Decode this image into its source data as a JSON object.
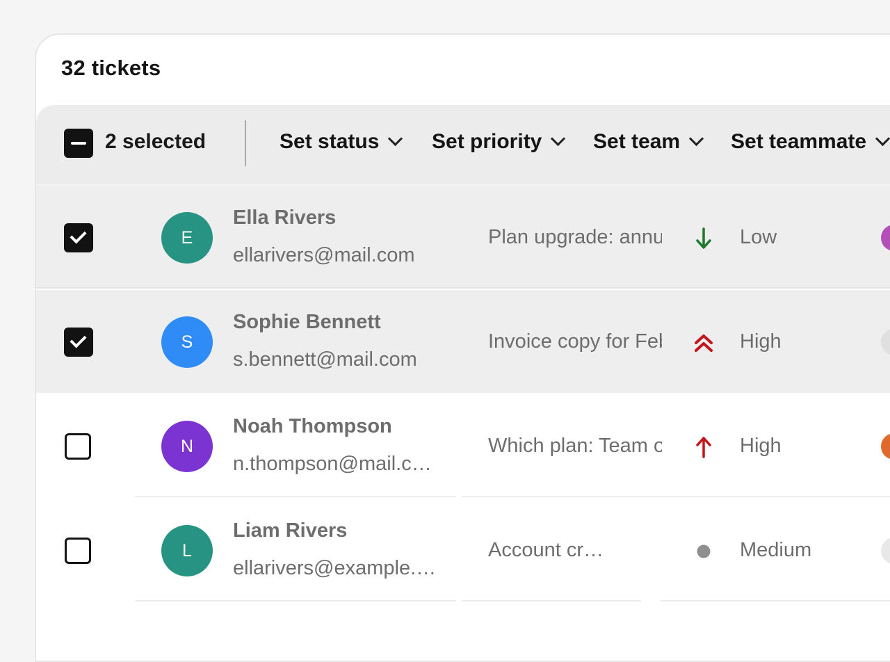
{
  "header": {
    "ticket_count": "32 tickets"
  },
  "bulk_bar": {
    "selected_label": "2 selected",
    "actions": [
      "Set status",
      "Set priority",
      "Set team",
      "Set teammate"
    ]
  },
  "rows": [
    {
      "initial": "E",
      "name": "Ella Rivers",
      "email": "ellarivers@mail.com",
      "subject": "Plan upgrade: annual",
      "priority": "Low",
      "priority_icon": "arrow-down-icon",
      "selected": true,
      "avatar_color": "#279383"
    },
    {
      "initial": "S",
      "name": "Sophie Bennett",
      "email": "s.bennett@mail.com",
      "subject": "Invoice copy for February",
      "priority": "High",
      "priority_icon": "double-chevron-up-icon",
      "selected": true,
      "avatar_color": "#2f8bf5"
    },
    {
      "initial": "N",
      "name": "Noah Thompson",
      "email": "n.thompson@mail.com",
      "subject": "Which plan: Team or Pro",
      "priority": "High",
      "priority_icon": "arrow-up-icon",
      "selected": false,
      "avatar_color": "#7b34d2"
    },
    {
      "initial": "L",
      "name": "Liam Rivers",
      "email": "ellarivers@example.com",
      "subject": "Account creation",
      "priority": "Medium",
      "priority_icon": "dot-icon",
      "selected": false,
      "avatar_color": "#279383"
    }
  ],
  "colors": {
    "low": "#1d7a2c",
    "high": "#c3161c",
    "medium": "#8f8f8f"
  }
}
